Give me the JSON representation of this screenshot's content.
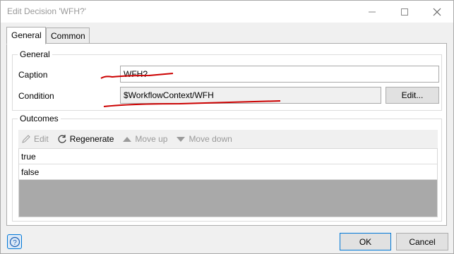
{
  "window": {
    "title": "Edit Decision 'WFH?'",
    "controls": {
      "minimize": "minimize-icon",
      "maximize": "maximize-icon",
      "close": "close-icon"
    }
  },
  "tabs": [
    {
      "label": "General",
      "active": true
    },
    {
      "label": "Common",
      "active": false
    }
  ],
  "general": {
    "group_title": "General",
    "caption_label": "Caption",
    "caption_value": "WFH?",
    "condition_label": "Condition",
    "condition_value": "$WorkflowContext/WFH",
    "edit_button": "Edit..."
  },
  "outcomes": {
    "group_title": "Outcomes",
    "toolbar": {
      "edit": "Edit",
      "regenerate": "Regenerate",
      "move_up": "Move up",
      "move_down": "Move down"
    },
    "items": [
      "true",
      "false"
    ]
  },
  "footer": {
    "help_icon": "help-icon",
    "ok": "OK",
    "cancel": "Cancel"
  },
  "colors": {
    "annotation_red": "#cc0000",
    "list_empty": "#a9a9a9",
    "ok_border": "#0078d7"
  }
}
